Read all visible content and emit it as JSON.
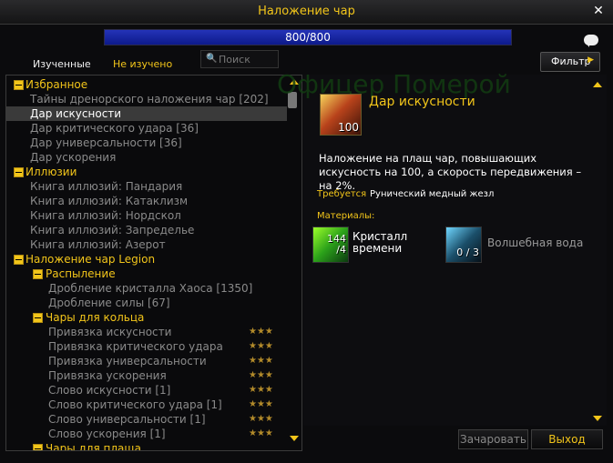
{
  "window": {
    "title": "Наложение чар"
  },
  "skill": {
    "text": "800/800",
    "progress": 1.0
  },
  "tabs": {
    "learned": "Изученные",
    "unlearned": "Не изучено"
  },
  "search": {
    "placeholder": "Поиск"
  },
  "filter": {
    "label": "Фильтр"
  },
  "recipe_list": [
    {
      "text": "Избранное",
      "kind": "header",
      "level": 0
    },
    {
      "text": "Тайны дренорского наложения чар  [202]",
      "kind": "recipe",
      "level": 1
    },
    {
      "text": "Дар искусности",
      "kind": "recipe",
      "level": 1,
      "selected": true
    },
    {
      "text": "Дар критического удара  [36]",
      "kind": "recipe",
      "level": 1
    },
    {
      "text": "Дар универсальности  [36]",
      "kind": "recipe",
      "level": 1
    },
    {
      "text": "Дар ускорения",
      "kind": "recipe",
      "level": 1
    },
    {
      "text": "Иллюзии",
      "kind": "header",
      "level": 0
    },
    {
      "text": "Книга иллюзий: Пандария",
      "kind": "recipe",
      "level": 1
    },
    {
      "text": "Книга иллюзий: Катаклизм",
      "kind": "recipe",
      "level": 1
    },
    {
      "text": "Книга иллюзий: Нордскол",
      "kind": "recipe",
      "level": 1
    },
    {
      "text": "Книга иллюзий: Запределье",
      "kind": "recipe",
      "level": 1
    },
    {
      "text": "Книга иллюзий: Азерот",
      "kind": "recipe",
      "level": 1
    },
    {
      "text": "Наложение чар Legion",
      "kind": "header",
      "level": 0
    },
    {
      "text": "Распыление",
      "kind": "subheader",
      "level": 1
    },
    {
      "text": "Дробление кристалла Хаоса  [1350]",
      "kind": "recipe",
      "level": 2
    },
    {
      "text": "Дробление силы  [67]",
      "kind": "recipe",
      "level": 2
    },
    {
      "text": "Чары для кольца",
      "kind": "subheader",
      "level": 1
    },
    {
      "text": "Привязка искусности",
      "kind": "recipe",
      "level": 2,
      "stars": "★★★"
    },
    {
      "text": "Привязка критического удара",
      "kind": "recipe",
      "level": 2,
      "stars": "★★★"
    },
    {
      "text": "Привязка универсальности",
      "kind": "recipe",
      "level": 2,
      "stars": "★★★"
    },
    {
      "text": "Привязка ускорения",
      "kind": "recipe",
      "level": 2,
      "stars": "★★★"
    },
    {
      "text": "Слово искусности  [1]",
      "kind": "recipe",
      "level": 2,
      "stars": "★★★"
    },
    {
      "text": "Слово критического удара  [1]",
      "kind": "recipe",
      "level": 2,
      "stars": "★★★"
    },
    {
      "text": "Слово универсальности  [1]",
      "kind": "recipe",
      "level": 2,
      "stars": "★★★"
    },
    {
      "text": "Слово ускорения  [1]",
      "kind": "recipe",
      "level": 2,
      "stars": "★★★"
    },
    {
      "text": "Чары для плаща",
      "kind": "subheader",
      "level": 1
    }
  ],
  "detail": {
    "watermark": "Офицер Померой",
    "recipe_name": "Дар искусности",
    "icon_count": "100",
    "description": "Наложение на плащ чар, повышающих искусность на 100, а скорость передвижения – на 2%.",
    "required_label": "Требуется",
    "required_value": "Рунический медный жезл",
    "materials_label": "Материалы:",
    "materials": [
      {
        "name": "Кристалл времени",
        "have": "144",
        "need": "/4"
      },
      {
        "name": "Волшебная вода",
        "count": "0 / 3"
      }
    ]
  },
  "buttons": {
    "enchant": "Зачаровать",
    "exit": "Выход"
  },
  "colors": {
    "header": "#f2c51a",
    "recipe_gray": "#8a8a8a",
    "skill_bar": "#2433b8"
  }
}
